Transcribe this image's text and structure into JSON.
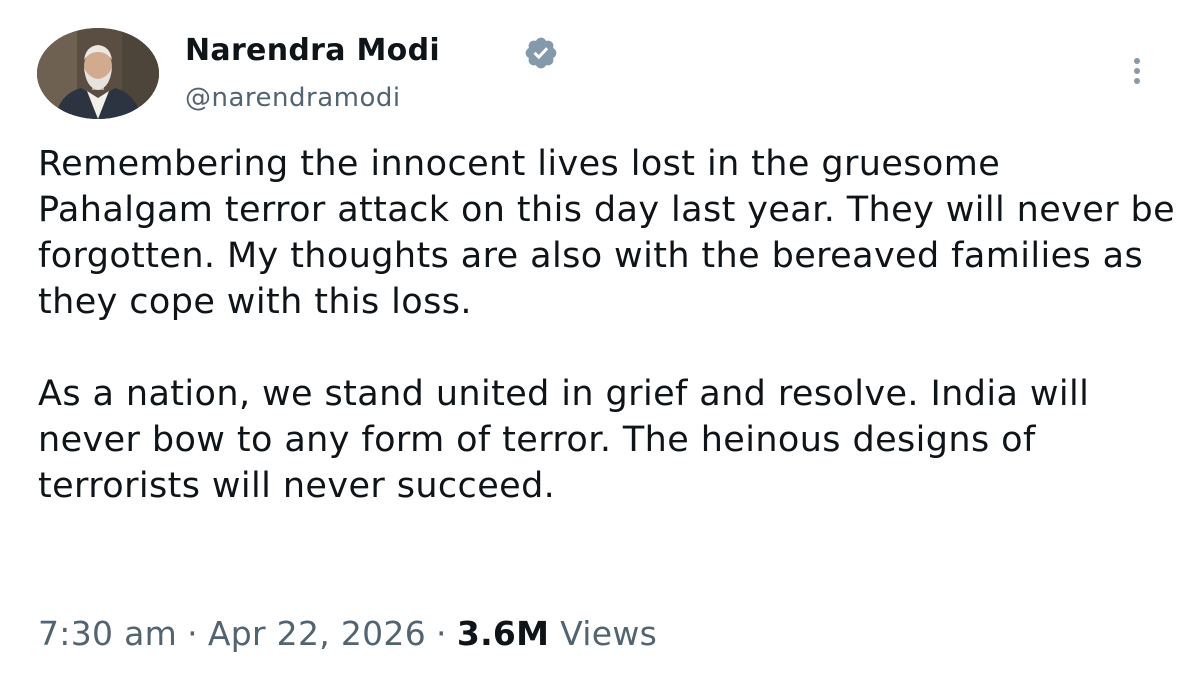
{
  "author": {
    "name": "Narendra Modi",
    "handle": "@narendramodi",
    "verified": true
  },
  "tweet": {
    "paragraphs": [
      "Remembering the innocent lives lost in the gruesome Pahalgam terror attack on this day last year. They will never be forgotten. My thoughts are also with the bereaved families as they cope with this loss.",
      "As a nation, we stand united in grief and resolve. India will never bow to any form of terror. The heinous designs of terrorists will never succeed."
    ],
    "time": "7:30 am",
    "date": "Apr 22, 2026",
    "separator": "·",
    "views_count": "3.6M",
    "views_label": "Views"
  },
  "icons": {
    "verified": "verified-badge-icon",
    "more": "more-options-icon"
  },
  "colors": {
    "text": "#0f1419",
    "secondary": "#536471",
    "background": "#ffffff"
  }
}
